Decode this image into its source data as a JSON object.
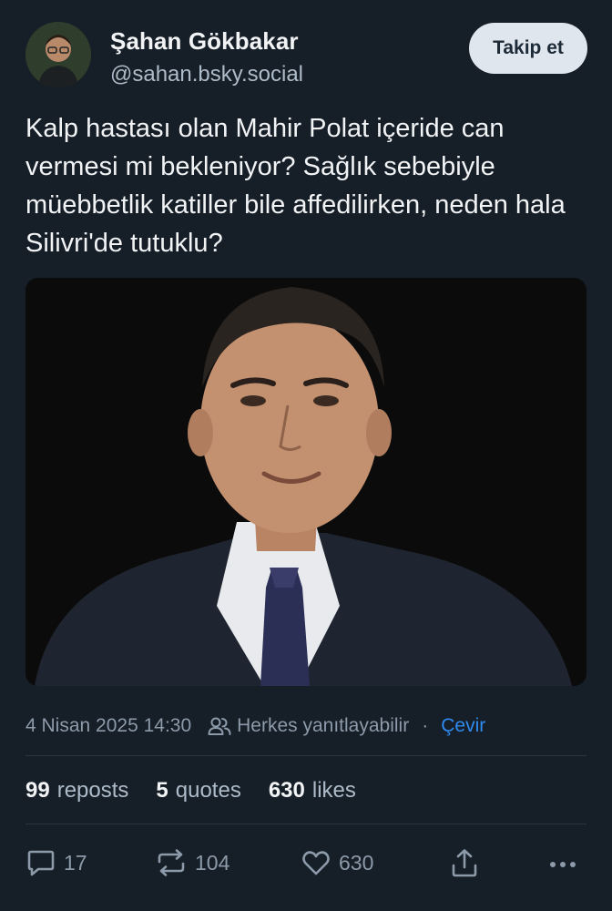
{
  "author": {
    "display_name": "Şahan Gökbakar",
    "handle": "@sahan.bsky.social",
    "avatar_icon": "avatar-photo"
  },
  "follow_button": {
    "label": "Takip et"
  },
  "post": {
    "text": "Kalp hastası olan Mahir Polat içeride can vermesi mi bekleniyor? Sağlık sebebiyle müebbetlik katiller bile affedilirken, neden hala Silivri'de tutuklu?",
    "image_icon": "photo-man-in-suit"
  },
  "meta": {
    "timestamp": "4 Nisan 2025 14:30",
    "reply_setting": "Herkes yanıtlayabilir",
    "separator": "·",
    "translate": "Çevir"
  },
  "stats": {
    "reposts_count": "99",
    "reposts_label": "reposts",
    "quotes_count": "5",
    "quotes_label": "quotes",
    "likes_count": "630",
    "likes_label": "likes"
  },
  "actions": {
    "reply_count": "17",
    "repost_count": "104",
    "like_count": "630"
  },
  "colors": {
    "background": "#161e27",
    "accent_link": "#2f8bf0",
    "muted_text": "#8c9aa9",
    "follow_button_bg": "#dfe6ee"
  }
}
